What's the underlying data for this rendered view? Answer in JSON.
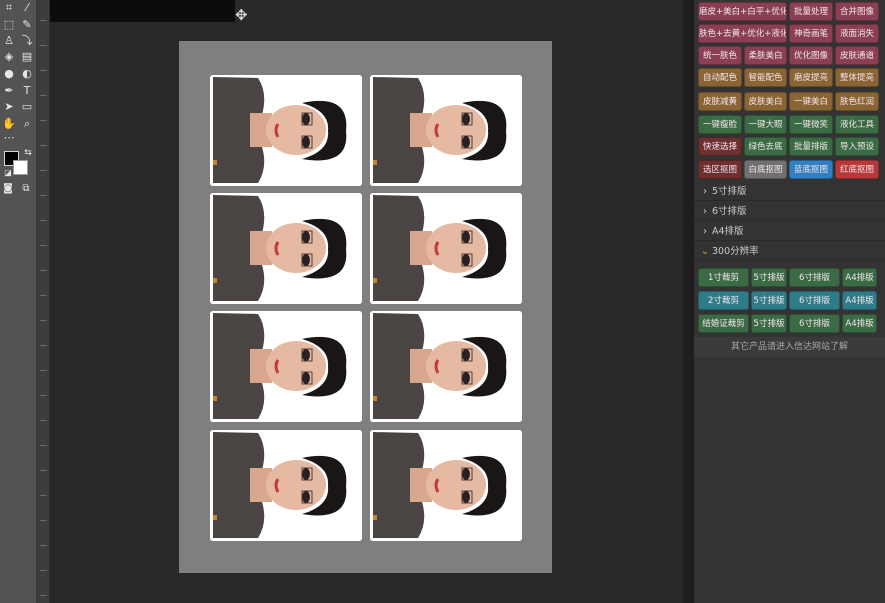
{
  "colors": {
    "magenta": "#8a3f54",
    "brown": "#8a6434",
    "green": "#3b6b45",
    "gray": "#707070",
    "blue": "#2f7fc2",
    "red": "#b8383a",
    "teal": "#2f7c88",
    "darkred": "#6e2f30"
  },
  "icons": [
    "crop-icon",
    "eyedropper-icon",
    "marquee-icon",
    "brush-icon",
    "stamp-icon",
    "history-brush-icon",
    "eraser-icon",
    "gradient-icon",
    "blur-icon",
    "dodge-icon",
    "pen-icon",
    "type-icon",
    "path-select-icon",
    "rectangle-icon",
    "hand-icon",
    "zoom-icon",
    "more-icon",
    "swap-colors-icon",
    "default-colors-icon",
    "quick-mask-icon",
    "screen-mode-icon"
  ],
  "panel": {
    "buttons": [
      [
        "磨皮+美白+白平+优化",
        "批量处理",
        "合并图像"
      ],
      [
        "肤色+去黄+优化+液化",
        "神奇画笔",
        "液面消失"
      ],
      [
        "统一肤色",
        "柔肤美白",
        "优化图像",
        "皮肤通道"
      ],
      [
        "自动配色",
        "智能配色",
        "磨皮提亮",
        "整体提亮"
      ],
      [
        "皮肤减黄",
        "皮肤美白",
        "一键美白",
        "肤色红润"
      ],
      [
        "一键瘦脸",
        "一键大眼",
        "一键微笑",
        "液化工具"
      ],
      [
        "快速选择",
        "绿色去底",
        "批量排版",
        "导入预设"
      ],
      [
        "选区抠图",
        "白底抠图",
        "蓝底抠图",
        "红底抠图"
      ]
    ],
    "sections": [
      {
        "chevron": "›",
        "label": "5寸排版"
      },
      {
        "chevron": "›",
        "label": "6寸排版"
      },
      {
        "chevron": "›",
        "label": "A4排版"
      },
      {
        "chevron": "⌄",
        "label": "300分辨率"
      }
    ],
    "res_buttons": [
      [
        "1寸裁剪",
        "5寸排版",
        "6寸排版",
        "A4排版"
      ],
      [
        "2寸裁剪",
        "5寸排版",
        "6寸排版",
        "A4排版"
      ],
      [
        "结婚证裁剪",
        "5寸排版",
        "6寸排版",
        "A4排版"
      ]
    ],
    "footer": "其它产品请进入信达网站了解"
  }
}
